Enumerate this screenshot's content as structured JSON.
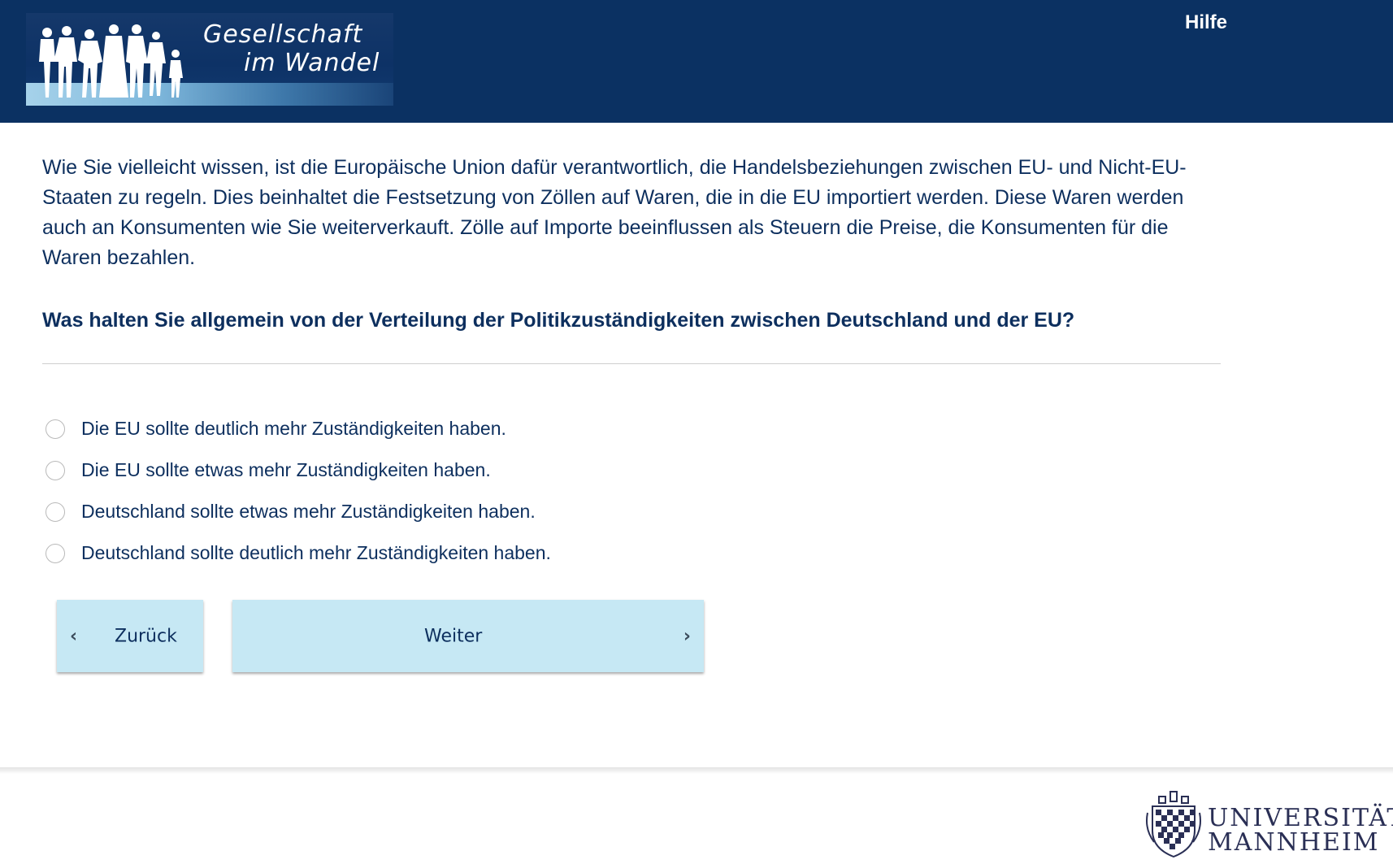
{
  "header": {
    "logo": {
      "line1": "Gesellschaft",
      "line2": "im Wandel",
      "icon": "family-silhouettes-icon"
    },
    "help_label": "Hilfe"
  },
  "main": {
    "intro": "Wie Sie vielleicht wissen, ist die Europäische Union dafür verantwortlich, die Handelsbeziehungen zwischen EU- und Nicht-EU-Staaten zu regeln. Dies beinhaltet die Festsetzung von Zöllen auf Waren, die in die EU importiert werden. Diese Waren werden auch an Konsumenten wie Sie weiterverkauft. Zölle auf Importe beeinflussen als Steuern die Preise, die Konsumenten für die Waren bezahlen.",
    "question": "Was halten Sie allgemein von der Verteilung der Politikzuständigkeiten zwischen Deutschland und der EU?",
    "options": [
      {
        "label": "Die EU sollte deutlich mehr Zuständigkeiten haben.",
        "selected": false
      },
      {
        "label": "Die EU sollte etwas mehr Zuständigkeiten haben.",
        "selected": false
      },
      {
        "label": "Deutschland sollte etwas mehr Zuständigkeiten haben.",
        "selected": false
      },
      {
        "label": "Deutschland sollte deutlich mehr Zuständigkeiten haben.",
        "selected": false
      }
    ]
  },
  "nav": {
    "back_label": "Zurück",
    "back_icon": "chevron-left-icon",
    "next_label": "Weiter",
    "next_icon": "chevron-right-icon"
  },
  "footer": {
    "university": {
      "line1": "UNIVERSITÄT",
      "line2": "MANNHEIM",
      "icon": "university-crest-icon"
    }
  },
  "colors": {
    "header_bg": "#0b3162",
    "text": "#0d2f5e",
    "button_bg": "#c6e8f4"
  }
}
